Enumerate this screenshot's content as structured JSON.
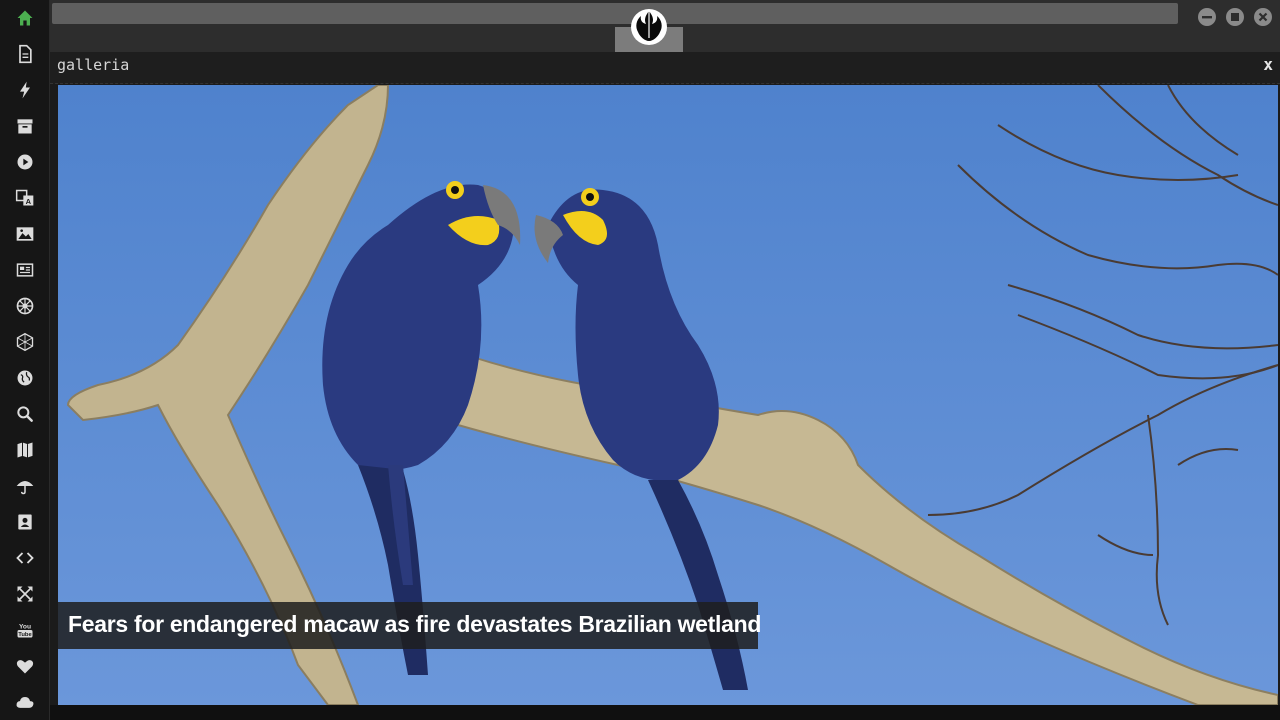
{
  "app": {
    "logo_icon": "rebel-alliance-icon",
    "window_controls": [
      "minimize-icon",
      "maximize-icon",
      "close-icon"
    ]
  },
  "sidebar": {
    "items": [
      {
        "icon": "home-icon",
        "active": true
      },
      {
        "icon": "document-icon"
      },
      {
        "icon": "lightning-icon"
      },
      {
        "icon": "archive-icon"
      },
      {
        "icon": "play-icon"
      },
      {
        "icon": "translate-icon"
      },
      {
        "icon": "image-icon"
      },
      {
        "icon": "newspaper-icon"
      },
      {
        "icon": "empire-icon"
      },
      {
        "icon": "network-icon"
      },
      {
        "icon": "globe-icon"
      },
      {
        "icon": "search-icon"
      },
      {
        "icon": "map-icon"
      },
      {
        "icon": "umbrella-icon"
      },
      {
        "icon": "contacts-icon"
      },
      {
        "icon": "code-icon"
      },
      {
        "icon": "expand-icon"
      },
      {
        "icon": "youtube-icon"
      },
      {
        "icon": "heart-icon"
      },
      {
        "icon": "cloud-icon"
      }
    ],
    "accent_color": "#4caf50",
    "icon_color": "#dcdcdc"
  },
  "panel": {
    "title": "galleria",
    "close_label": "x"
  },
  "gallery": {
    "caption": "Fears for endangered macaw as fire devastates Brazilian wetland",
    "sky_color": "#5b8ad0"
  }
}
